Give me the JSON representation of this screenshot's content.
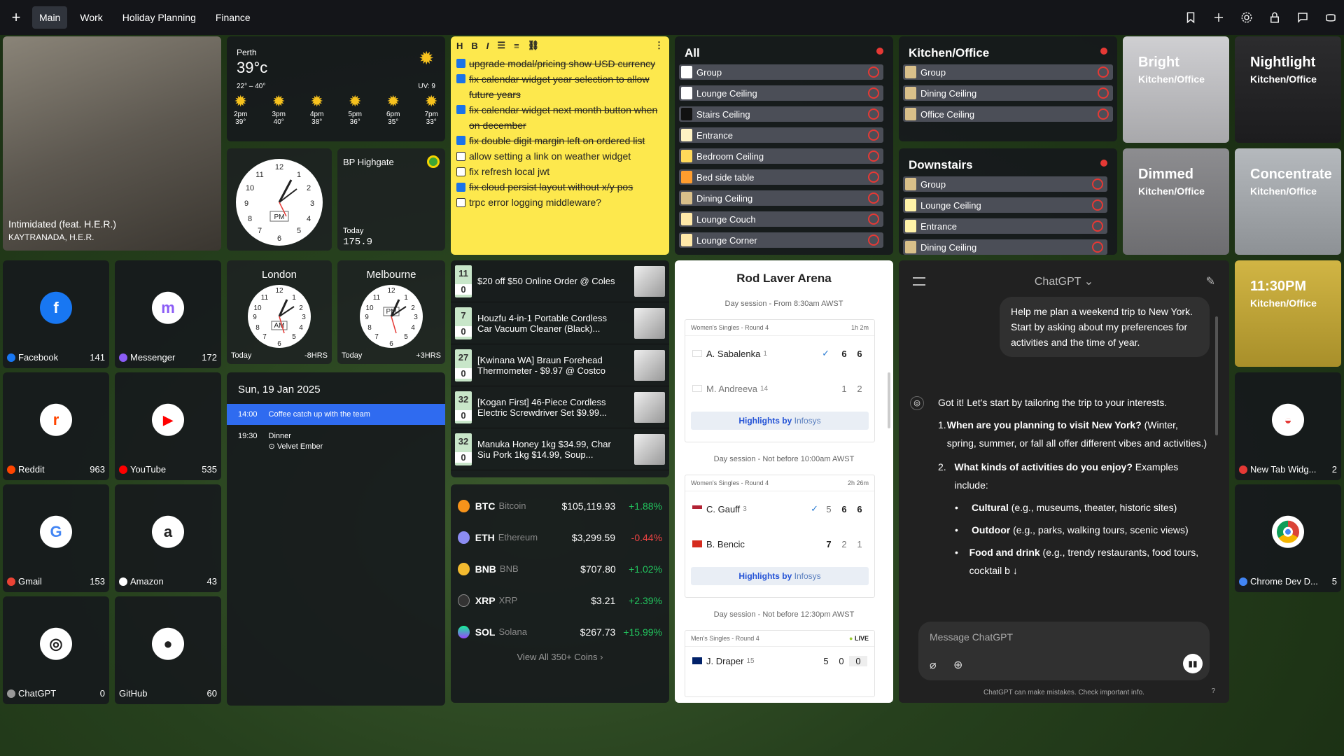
{
  "tabs": [
    "Main",
    "Work",
    "Holiday Planning",
    "Finance"
  ],
  "music": {
    "title": "Intimidated (feat. H.E.R.)",
    "artist": "KAYTRANADA, H.E.R."
  },
  "weather": {
    "city": "Perth",
    "temp": "39°c",
    "range": "22° – 40°",
    "uv": "UV: 9",
    "hours": [
      {
        "t": "2pm",
        "v": "39°"
      },
      {
        "t": "3pm",
        "v": "40°"
      },
      {
        "t": "4pm",
        "v": "38°"
      },
      {
        "t": "5pm",
        "v": "36°"
      },
      {
        "t": "6pm",
        "v": "35°"
      },
      {
        "t": "7pm",
        "v": "33°"
      }
    ]
  },
  "fuel": {
    "station": "BP Highgate",
    "label": "Today",
    "price": "175.9"
  },
  "clocks": {
    "london": {
      "name": "London",
      "day": "Today",
      "offset": "-8HRS",
      "ampm": "AM"
    },
    "melbourne": {
      "name": "Melbourne",
      "day": "Today",
      "offset": "+3HRS",
      "ampm": "PM"
    },
    "main": {
      "ampm": "PM"
    }
  },
  "calendar": {
    "date": "Sun, 19 Jan 2025",
    "events": [
      {
        "time": "14:00",
        "title": "Coffee catch up with the team"
      },
      {
        "time": "19:30",
        "title": "Dinner",
        "loc": "Velvet Ember"
      }
    ]
  },
  "todos": [
    {
      "text": "upgrade modal/pricing show USD currency",
      "done": true
    },
    {
      "text": "fix calendar widget year selection to allow future years",
      "done": true
    },
    {
      "text": "fix calendar widget next month button when on december",
      "done": true
    },
    {
      "text": "fix double digit margin left on ordered list",
      "done": true
    },
    {
      "text": "allow setting a link on weather widget",
      "done": false
    },
    {
      "text": "fix refresh local jwt",
      "done": false
    },
    {
      "text": "fix cloud persist layout without x/y pos",
      "done": true
    },
    {
      "text": "trpc error logging middleware?",
      "done": false
    }
  ],
  "toolbar": [
    "H",
    "B",
    "I"
  ],
  "lights_all": {
    "title": "All",
    "items": [
      {
        "n": "Group",
        "c": "#ffffff"
      },
      {
        "n": "Lounge Ceiling",
        "c": "#ffffff"
      },
      {
        "n": "Stairs Ceiling",
        "c": "#111111"
      },
      {
        "n": "Entrance",
        "c": "#fff3c4"
      },
      {
        "n": "Bedroom Ceiling",
        "c": "#ffd95a"
      },
      {
        "n": "Bed side table",
        "c": "#ff9d2e"
      },
      {
        "n": "Dining Ceiling",
        "c": "#d9c08a"
      },
      {
        "n": "Lounge Couch",
        "c": "#ffe9a8"
      },
      {
        "n": "Lounge Corner",
        "c": "#ffe9a8"
      }
    ]
  },
  "lights_kitchen": {
    "title": "Kitchen/Office",
    "items": [
      {
        "n": "Group",
        "c": "#d9c08a"
      },
      {
        "n": "Dining Ceiling",
        "c": "#d9c08a"
      },
      {
        "n": "Office Ceiling",
        "c": "#d9c08a"
      }
    ]
  },
  "lights_down": {
    "title": "Downstairs",
    "items": [
      {
        "n": "Group",
        "c": "#d9c08a"
      },
      {
        "n": "Lounge Ceiling",
        "c": "#fff3a8"
      },
      {
        "n": "Entrance",
        "c": "#fff3a8"
      },
      {
        "n": "Dining Ceiling",
        "c": "#d9c08a"
      }
    ]
  },
  "scenes": [
    {
      "n": "Bright",
      "r": "Kitchen/Office"
    },
    {
      "n": "Nightlight",
      "r": "Kitchen/Office"
    },
    {
      "n": "Dimmed",
      "r": "Kitchen/Office"
    },
    {
      "n": "Concentrate",
      "r": "Kitchen/Office"
    },
    {
      "n": "11:30PM",
      "r": "Kitchen/Office"
    }
  ],
  "apps": [
    {
      "n": "Facebook",
      "c": "141",
      "col": "#1877f2",
      "g": "f"
    },
    {
      "n": "Messenger",
      "c": "172",
      "col": "#8b5cf6",
      "g": "m"
    },
    {
      "n": "Reddit",
      "c": "963",
      "col": "#ff4500",
      "g": "r"
    },
    {
      "n": "YouTube",
      "c": "535",
      "col": "#ff0000",
      "g": "▶"
    },
    {
      "n": "Gmail",
      "c": "153",
      "col": "#ea4335",
      "g": "G"
    },
    {
      "n": "Amazon",
      "c": "43",
      "col": "#222",
      "g": "a"
    },
    {
      "n": "ChatGPT",
      "c": "0",
      "col": "#555",
      "g": "◎"
    },
    {
      "n": "GitHub",
      "c": "60",
      "col": "#222",
      "g": "●"
    }
  ],
  "apps_right": [
    {
      "n": "New Tab Widg...",
      "c": "2"
    },
    {
      "n": "Chrome Dev D...",
      "c": "5"
    }
  ],
  "deals": [
    {
      "up": "11",
      "down": "0",
      "t": "$20 off $50 Online Order @ Coles"
    },
    {
      "up": "7",
      "down": "0",
      "t": "Houzfu 4-in-1 Portable Cordless Car Vacuum Cleaner (Black)..."
    },
    {
      "up": "27",
      "down": "0",
      "t": "[Kwinana WA] Braun Forehead Thermometer - $9.97 @ Costco"
    },
    {
      "up": "32",
      "down": "0",
      "t": "[Kogan First] 46-Piece Cordless Electric Screwdriver Set $9.99..."
    },
    {
      "up": "32",
      "down": "0",
      "t": "Manuka Honey 1kg $34.99, Char Siu Pork 1kg $14.99, Soup..."
    }
  ],
  "crypto": [
    {
      "s": "BTC",
      "n": "Bitcoin",
      "p": "$105,119.93",
      "ch": "+1.88%",
      "col": "#f7931a",
      "up": true
    },
    {
      "s": "ETH",
      "n": "Ethereum",
      "p": "$3,299.59",
      "ch": "-0.44%",
      "col": "#8c8cf2",
      "up": false
    },
    {
      "s": "BNB",
      "n": "BNB",
      "p": "$707.80",
      "ch": "+1.02%",
      "col": "#f3ba2f",
      "up": true
    },
    {
      "s": "XRP",
      "n": "XRP",
      "p": "$3.21",
      "ch": "+2.39%",
      "col": "#333",
      "up": true
    },
    {
      "s": "SOL",
      "n": "Solana",
      "p": "$267.73",
      "ch": "+15.99%",
      "col": "#14f195",
      "up": true
    }
  ],
  "crypto_more": "View All 350+ Coins",
  "tennis": {
    "title": "Rod Laver Arena",
    "s1": "Day session - From 8:30am AWST",
    "m1": {
      "round": "Women's Singles - Round 4",
      "dur": "1h 2m",
      "p1": "A. Sabalenka",
      "r1": "1",
      "sc1": [
        "6",
        "6"
      ],
      "p2": "M. Andreeva",
      "r2": "14",
      "sc2": [
        "1",
        "2"
      ]
    },
    "hl": "Highlights by",
    "sponsor": "Infosys",
    "s2": "Day session - Not before 10:00am AWST",
    "m2": {
      "round": "Women's Singles - Round 4",
      "dur": "2h 26m",
      "p1": "C. Gauff",
      "r1": "3",
      "sc1": [
        "5",
        "6",
        "6"
      ],
      "p2": "B. Bencic",
      "sc2": [
        "7",
        "2",
        "1"
      ]
    },
    "s3": "Day session - Not before 12:30pm AWST",
    "m3": {
      "round": "Men's Singles - Round 4",
      "live": "LIVE",
      "p1": "J. Draper",
      "r1": "15",
      "sc1": [
        "5",
        "0",
        "0"
      ]
    }
  },
  "chat": {
    "title": "ChatGPT",
    "user": "Help me plan a weekend trip to New York. Start by asking about my preferences for activities and the time of year.",
    "reply": "Got it! Let's start by tailoring the trip to your interests.",
    "q1b": "When are you planning to visit New York?",
    "q1": " (Winter, spring, summer, or fall all offer different vibes and activities.)",
    "q2b": "What kinds of activities do you enjoy?",
    "q2": " Examples include:",
    "b1b": "Cultural",
    "b1": " (e.g., museums, theater, historic sites)",
    "b2b": "Outdoor",
    "b2": " (e.g., parks, walking tours, scenic views)",
    "b3b": "Food and drink",
    "b3": " (e.g., trendy restaurants, food tours, cocktail b",
    "placeholder": "Message ChatGPT",
    "disclaimer": "ChatGPT can make mistakes. Check important info.",
    "help": "?"
  }
}
